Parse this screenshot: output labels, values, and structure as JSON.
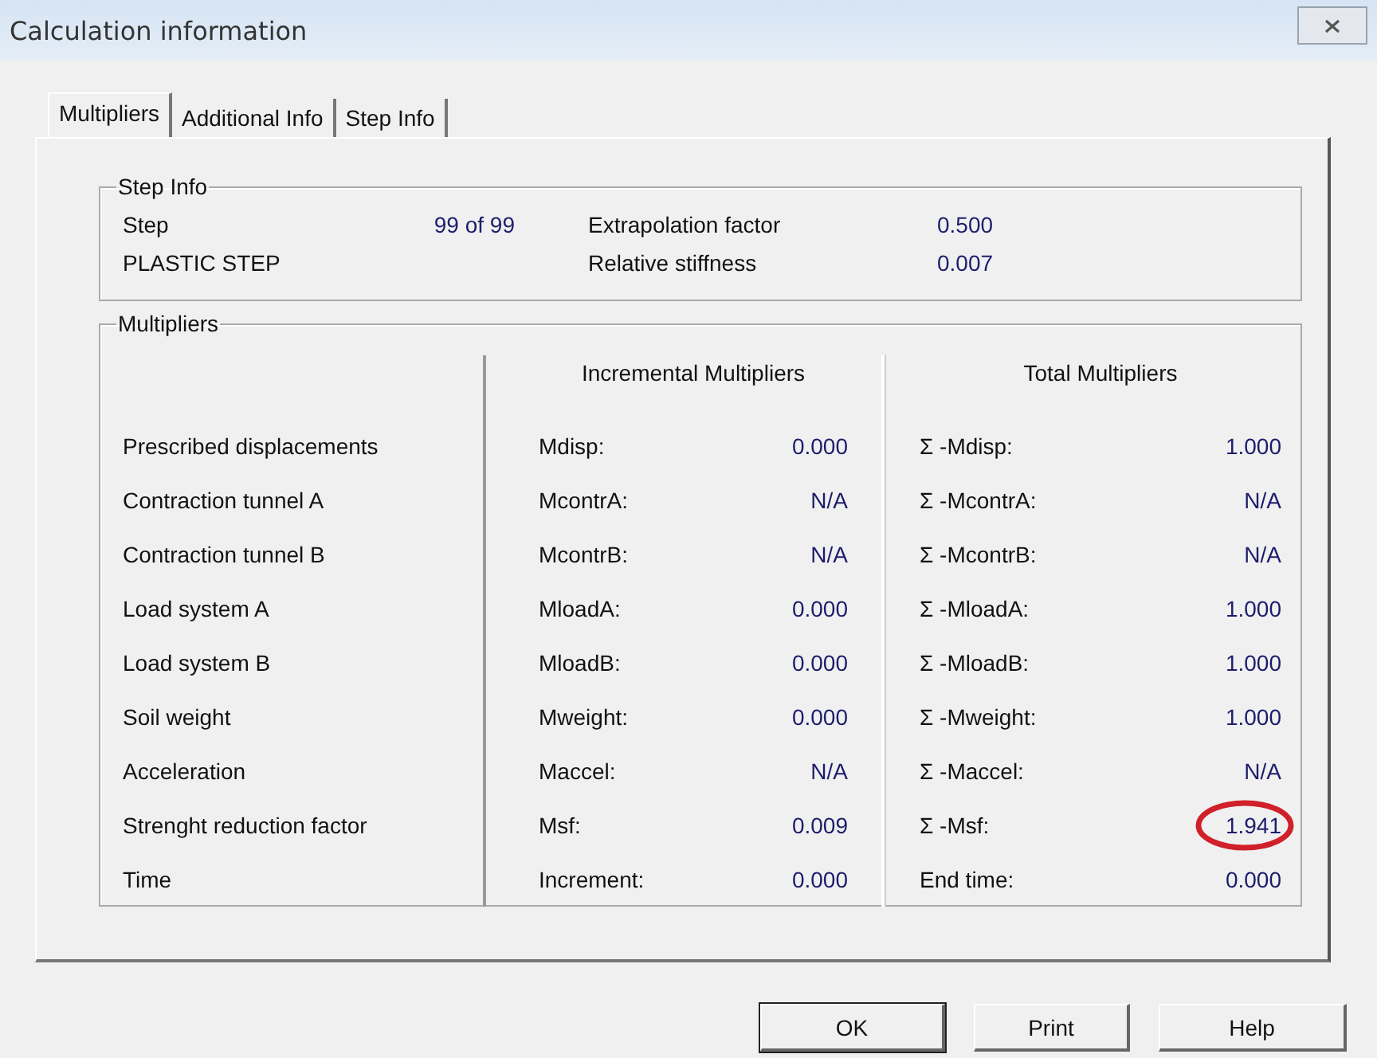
{
  "window": {
    "title": "Calculation information"
  },
  "tabs": [
    {
      "label": "Multipliers",
      "selected": true
    },
    {
      "label": "Additional Info",
      "selected": false
    },
    {
      "label": "Step Info",
      "selected": false
    }
  ],
  "step_info": {
    "title": "Step Info",
    "rows": [
      {
        "label": "Step",
        "value": "99 of 99",
        "label_2": "Extrapolation factor",
        "value_2": "0.500"
      },
      {
        "label": "PLASTIC STEP",
        "label_2": "Relative stiffness",
        "value_2": "0.007"
      }
    ]
  },
  "multipliers": {
    "title": "Multipliers",
    "columns": [
      "Incremental Multipliers",
      "Total Multipliers"
    ],
    "rows": [
      {
        "name": "Prescribed displacements",
        "inc_label": "Mdisp:",
        "inc_value": "0.000",
        "total_label": "Σ -Mdisp:",
        "total_value": "1.000",
        "highlighted": false
      },
      {
        "name": "Contraction tunnel A",
        "inc_label": "McontrA:",
        "inc_value": "N/A",
        "total_label": "Σ -McontrA:",
        "total_value": "N/A",
        "highlighted": false
      },
      {
        "name": "Contraction tunnel B",
        "inc_label": "McontrB:",
        "inc_value": "N/A",
        "total_label": "Σ -McontrB:",
        "total_value": "N/A",
        "highlighted": false
      },
      {
        "name": "Load system A",
        "inc_label": "MloadA:",
        "inc_value": "0.000",
        "total_label": "Σ -MloadA:",
        "total_value": "1.000",
        "highlighted": false
      },
      {
        "name": "Load system B",
        "inc_label": "MloadB:",
        "inc_value": "0.000",
        "total_label": "Σ -MloadB:",
        "total_value": "1.000",
        "highlighted": false
      },
      {
        "name": "Soil weight",
        "inc_label": "Mweight:",
        "inc_value": "0.000",
        "total_label": "Σ -Mweight:",
        "total_value": "1.000",
        "highlighted": false
      },
      {
        "name": "Acceleration",
        "inc_label": "Maccel:",
        "inc_value": "N/A",
        "total_label": "Σ -Maccel:",
        "total_value": "N/A",
        "highlighted": false
      },
      {
        "name": "Strenght reduction factor",
        "inc_label": "Msf:",
        "inc_value": "0.009",
        "total_label": "Σ -Msf:",
        "total_value": "1.941",
        "highlighted": true
      },
      {
        "name": "Time",
        "inc_label": "Increment:",
        "inc_value": "0.000",
        "total_label": "End time:",
        "total_value": "0.000",
        "highlighted": false
      }
    ]
  },
  "buttons": [
    {
      "label": "OK",
      "default": true
    },
    {
      "label": "Print",
      "default": false
    },
    {
      "label": "Help",
      "default": false
    }
  ]
}
